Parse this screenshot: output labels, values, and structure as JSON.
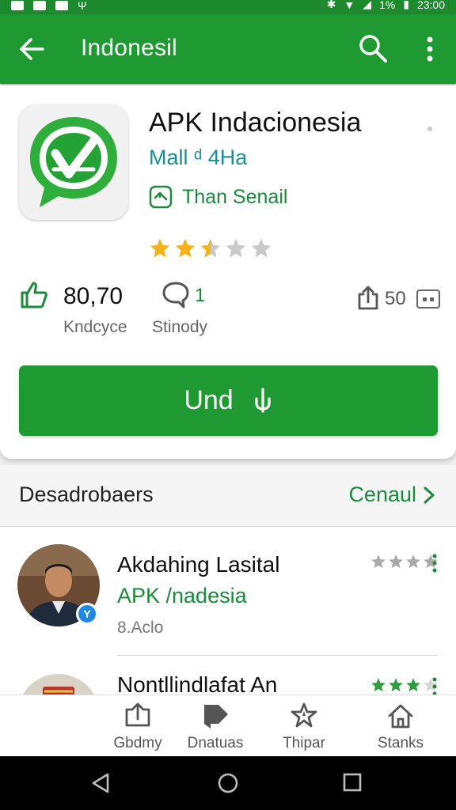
{
  "status_bar": {
    "time": "23:00",
    "battery": "1%"
  },
  "app_bar": {
    "title": "Indonesil"
  },
  "app": {
    "name": "APK Indacionesia",
    "subtitle": "Mall ᵈ 4Ha",
    "developer_label": "Than Senail",
    "rating": 2.5,
    "rating_max": 5
  },
  "stats": {
    "likes_value": "80,70",
    "likes_caption": "Kndcyce",
    "comments_value": "1",
    "comments_caption": "Stinody",
    "shares_value": "50"
  },
  "install_button": {
    "label": "Und"
  },
  "developers_section": {
    "title": "Desadrobaers",
    "more_label": "Cenaul"
  },
  "developers": [
    {
      "name": "Akdahing Lasital",
      "subtitle": "APK /nadesia",
      "meta": "8.Aclo",
      "badge": "Y",
      "rating": 4,
      "badge_color": "#1e88e5"
    },
    {
      "name": "Nontllindlafat An",
      "subtitle": "",
      "meta": "",
      "badge": "✓",
      "rating": 3,
      "badge_color": "#1f9a33"
    }
  ],
  "bottom_nav": [
    {
      "label": "Gbdmy",
      "icon": "share-box-icon"
    },
    {
      "label": "Dnatuas",
      "icon": "tag-icon"
    },
    {
      "label": "Thipar",
      "icon": "star-badge-icon"
    },
    {
      "label": "Stanks",
      "icon": "home-icon"
    }
  ],
  "colors": {
    "primary": "#1f9a33",
    "accent_teal": "#1a8f96",
    "star_gold": "#f5b21b"
  }
}
